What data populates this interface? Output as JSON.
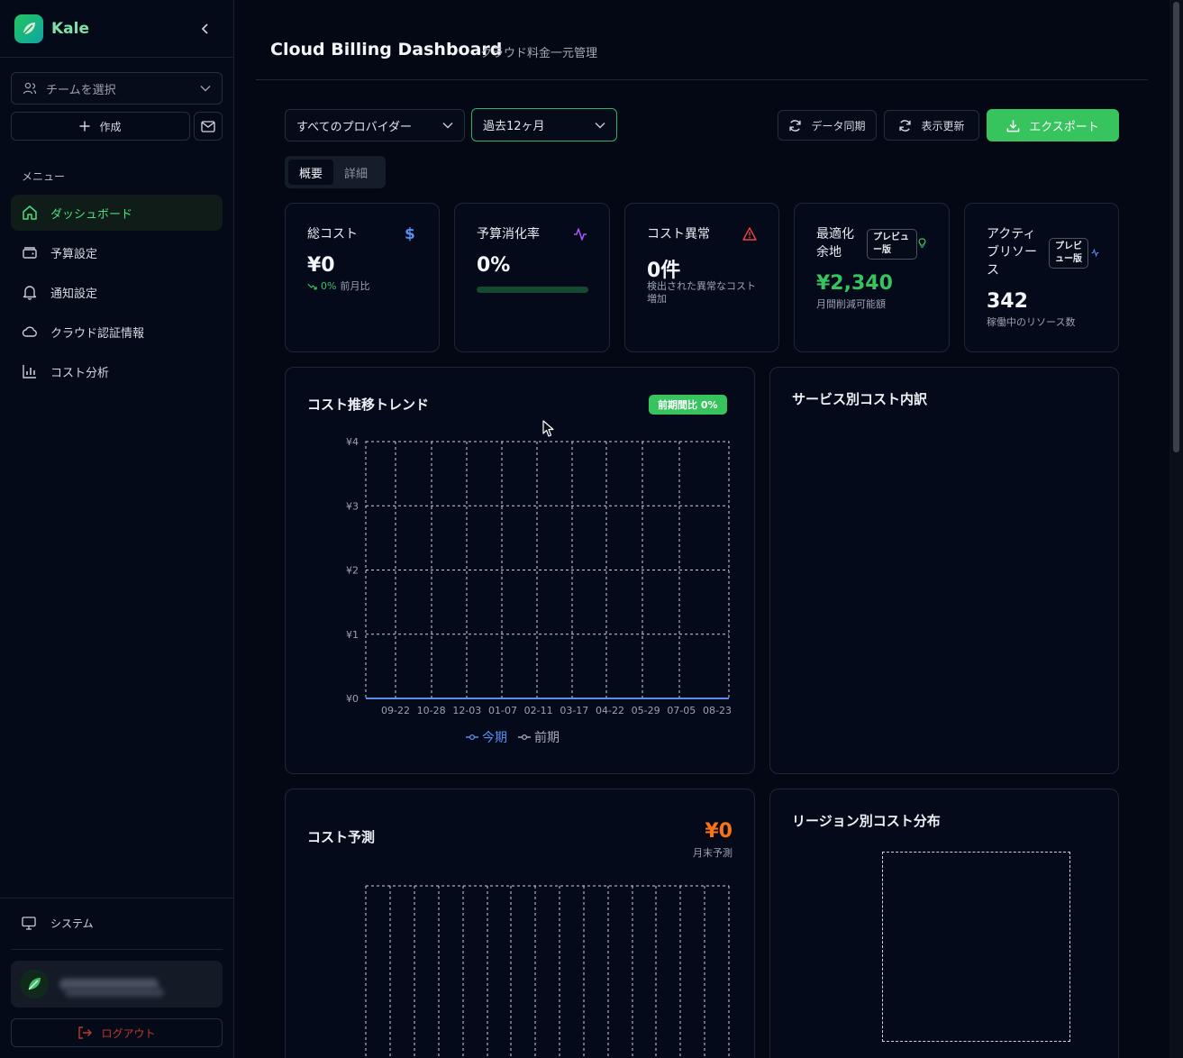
{
  "brand": {
    "name": "Kale"
  },
  "sidebar": {
    "team_placeholder": "チームを選択",
    "create_label": "作成",
    "menu_label": "メニュー",
    "items": [
      {
        "label": "ダッシュボード",
        "icon": "home-icon",
        "active": true
      },
      {
        "label": "予算設定",
        "icon": "wallet-icon"
      },
      {
        "label": "通知設定",
        "icon": "bell-icon"
      },
      {
        "label": "クラウド認証情報",
        "icon": "cloud-icon"
      },
      {
        "label": "コスト分析",
        "icon": "bar-chart-icon"
      }
    ],
    "system_label": "システム",
    "logout_label": "ログアウト"
  },
  "header": {
    "title": "Cloud Billing Dashboard",
    "subtitle": "クラウド料金一元管理"
  },
  "filters": {
    "provider": "すべてのプロバイダー",
    "period": "過去12ヶ月",
    "sync_label": "データ同期",
    "refresh_label": "表示更新",
    "export_label": "エクスポート"
  },
  "tabs": [
    {
      "label": "概要",
      "active": true
    },
    {
      "label": "詳細"
    }
  ],
  "kpis": {
    "total_cost": {
      "title": "総コスト",
      "value": "¥0",
      "change": "0%",
      "change_label": "前月比"
    },
    "budget": {
      "title": "予算消化率",
      "value": "0%",
      "progress": 0
    },
    "anomaly": {
      "title": "コスト異常",
      "value": "0件",
      "sub": "検出された異常なコスト増加"
    },
    "optimization": {
      "title": "最適化余地",
      "badge": "プレビュー版",
      "value": "¥2,340",
      "sub": "月間削減可能額"
    },
    "resources": {
      "title": "アクティブリソース",
      "badge": "プレビュー版",
      "value": "342",
      "sub": "稼働中のリソース数"
    }
  },
  "trend": {
    "title": "コスト推移トレンド",
    "badge": "前期間比 0%",
    "legend_current": "今期",
    "legend_previous": "前期"
  },
  "service_breakdown": {
    "title": "サービス別コスト内訳"
  },
  "forecast": {
    "title": "コスト予測",
    "value": "¥0",
    "sub": "月末予測"
  },
  "region": {
    "title": "リージョン別コスト分布"
  },
  "colors": {
    "accent": "#37c45e",
    "current_series": "#5b8def",
    "forecast": "#f97316"
  },
  "chart_data": {
    "type": "line",
    "x": [
      "09-22",
      "10-28",
      "12-03",
      "01-07",
      "02-11",
      "03-17",
      "04-22",
      "05-29",
      "07-05",
      "08-23"
    ],
    "y_ticks": [
      "¥0",
      "¥1",
      "¥2",
      "¥3",
      "¥4"
    ],
    "ylim": [
      0,
      4
    ],
    "series": [
      {
        "name": "今期",
        "values": [
          0,
          0,
          0,
          0,
          0,
          0,
          0,
          0,
          0,
          0
        ]
      },
      {
        "name": "前期",
        "values": [
          0,
          0,
          0,
          0,
          0,
          0,
          0,
          0,
          0,
          0
        ]
      }
    ],
    "grid": true
  }
}
